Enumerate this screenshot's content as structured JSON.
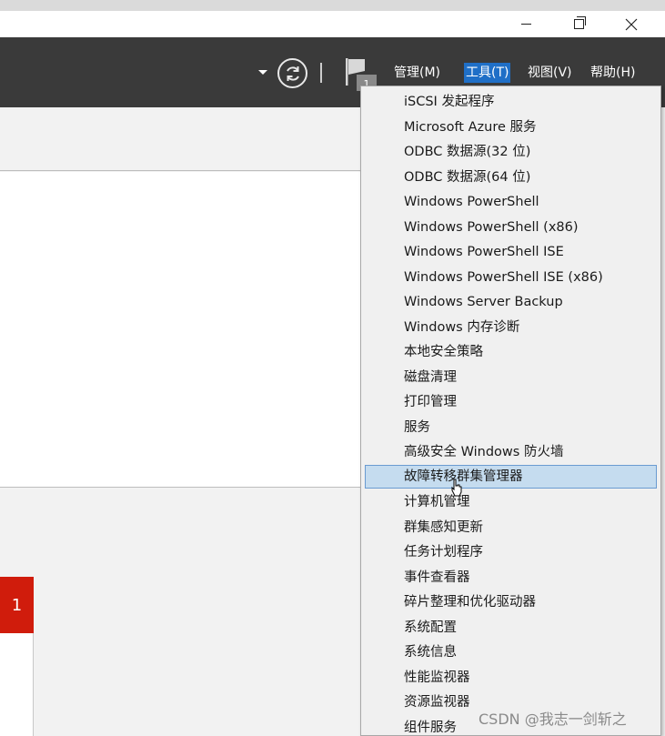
{
  "window": {
    "controls": [
      "minimize-icon",
      "maximize-icon",
      "close-icon"
    ]
  },
  "header": {
    "notification_count": "1",
    "menus": [
      {
        "label": "管理(M)",
        "active": false
      },
      {
        "label": "工具(T)",
        "active": true
      },
      {
        "label": "视图(V)",
        "active": false
      },
      {
        "label": "帮助(H)",
        "active": false
      }
    ]
  },
  "dashboard": {
    "tile_count": "1"
  },
  "tools_menu": {
    "items": [
      "iSCSI 发起程序",
      "Microsoft Azure 服务",
      "ODBC 数据源(32 位)",
      "ODBC 数据源(64 位)",
      "Windows PowerShell",
      "Windows PowerShell (x86)",
      "Windows PowerShell ISE",
      "Windows PowerShell ISE (x86)",
      "Windows Server Backup",
      "Windows 内存诊断",
      "本地安全策略",
      "磁盘清理",
      "打印管理",
      "服务",
      "高级安全 Windows 防火墙",
      "故障转移群集管理器",
      "计算机管理",
      "群集感知更新",
      "任务计划程序",
      "事件查看器",
      "碎片整理和优化驱动器",
      "系统配置",
      "系统信息",
      "性能监视器",
      "资源监视器",
      "组件服务"
    ],
    "highlighted": "故障转移群集管理器"
  },
  "watermark": "CSDN @我志一剑斩之",
  "colors": {
    "header_bg": "#3a3a3a",
    "menu_active": "#1f6fc7",
    "hover_bg": "#c5dcef",
    "alert_tile": "#d01c0c"
  }
}
